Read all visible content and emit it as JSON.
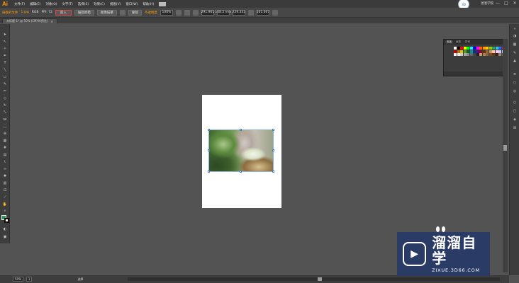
{
  "app": {
    "logo": "Ai"
  },
  "menu": [
    "文件(F)",
    "编辑(E)",
    "对象(O)",
    "文字(T)",
    "选择(S)",
    "效果(C)",
    "视图(V)",
    "窗口(W)",
    "帮助(H)"
  ],
  "user": {
    "name": "溜溜学院",
    "avatar_text": "3D"
  },
  "window_controls": [
    "—",
    "□",
    "✕"
  ],
  "control_bar": {
    "left_label": "链接的文件",
    "items": [
      "1.jpg",
      "RGB",
      "PPI: 72",
      "嵌入",
      "编辑原稿",
      "图像描摹",
      "蒙版",
      "不透明度",
      "100%"
    ],
    "active_button": "嵌入",
    "x_value": "291.961",
    "y_value": "148.5 mm",
    "w_value": "229.333",
    "h_value": "161.667"
  },
  "document_tab": {
    "title": "未标题-1* @ 50% (CMYK/预览)",
    "close": "✕"
  },
  "swatch_panel": {
    "tabs": [
      "色板",
      "画笔",
      "符号"
    ]
  },
  "status": {
    "zoom": "50%",
    "page": "1",
    "mode": "选择"
  },
  "watermark": {
    "title": "溜溜自学",
    "url": "ZIXUE.3D66.COM",
    "icon": "play-icon"
  },
  "colors": {
    "accent": "#ff9a00",
    "fill": "#22a05a",
    "watermark_bg": "#2a3b66"
  }
}
